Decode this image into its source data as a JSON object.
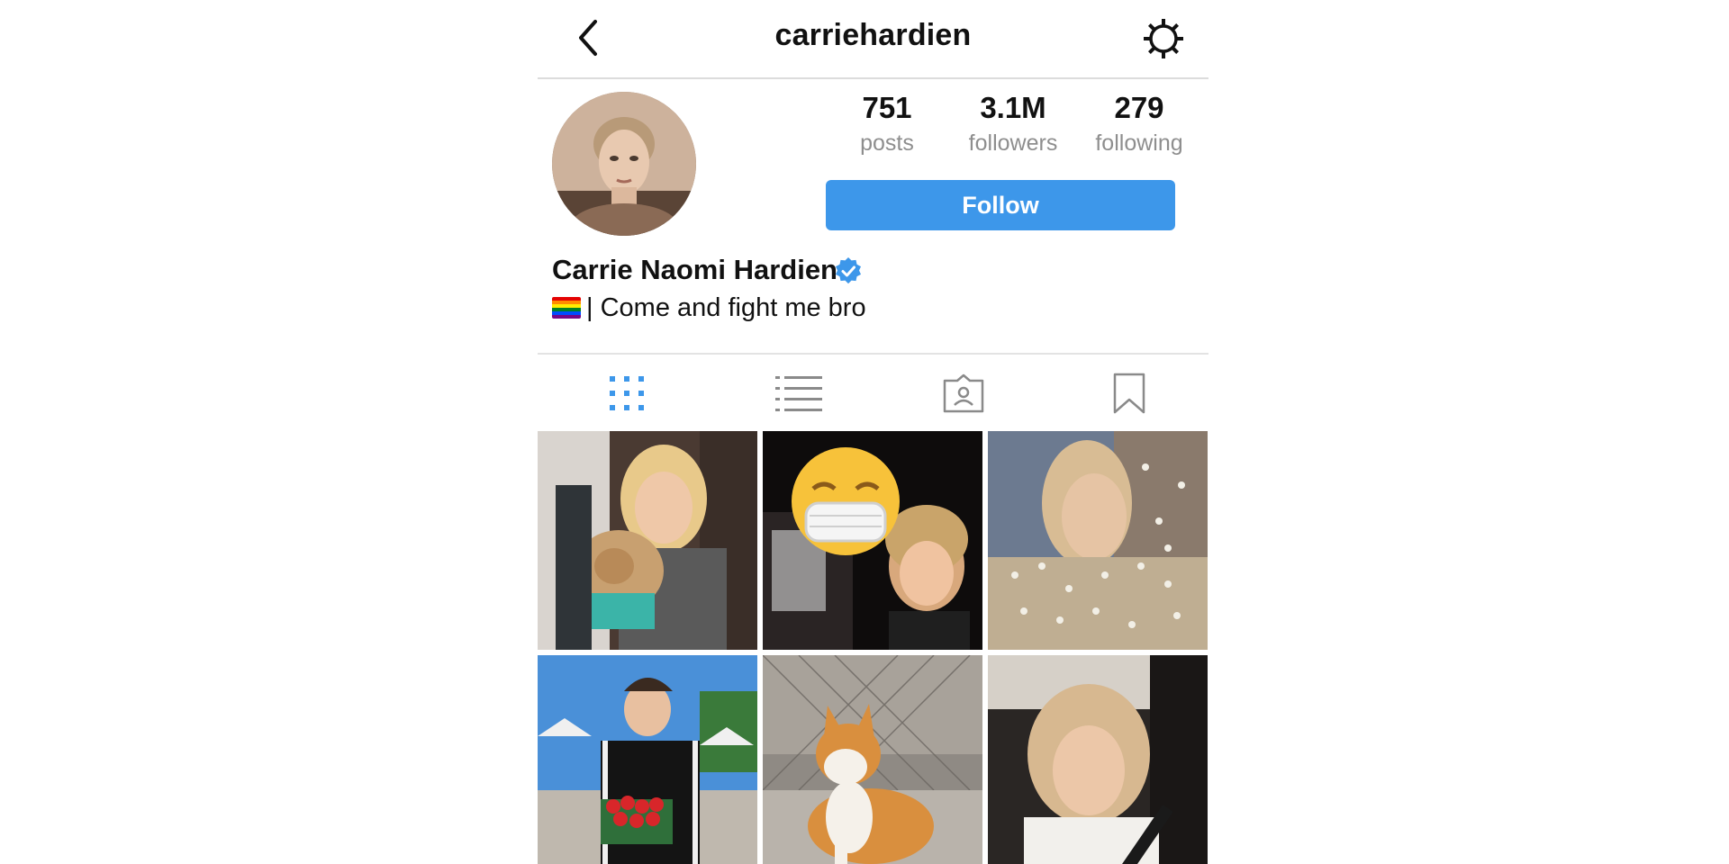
{
  "header": {
    "username": "carriehardien",
    "back_icon": "chevron-left-icon",
    "settings_icon": "gear-icon"
  },
  "profile": {
    "stats": [
      {
        "count": "751",
        "label": "posts"
      },
      {
        "count": "3.1M",
        "label": "followers"
      },
      {
        "count": "279",
        "label": "following"
      }
    ],
    "follow_label": "Follow",
    "full_name": "Carrie Naomi Hardien",
    "verified": true,
    "bio": "| Come and fight me bro",
    "bio_flag": "rainbow-flag-emoji"
  },
  "tabs": [
    {
      "name": "grid-view",
      "icon": "grid-icon",
      "active": true
    },
    {
      "name": "list-view",
      "icon": "list-icon",
      "active": false
    },
    {
      "name": "tagged",
      "icon": "tagged-person-icon",
      "active": false
    },
    {
      "name": "saved",
      "icon": "bookmark-icon",
      "active": false
    }
  ],
  "colors": {
    "accent": "#3d97ea",
    "muted_text": "#8e8e8e",
    "divider": "#dcdcdc",
    "icon_gray": "#8a8a8a"
  },
  "posts": [
    {
      "name": "post-photo-girl-with-puppy"
    },
    {
      "name": "post-photo-emoji-selfie"
    },
    {
      "name": "post-photo-flowers-portrait"
    },
    {
      "name": "post-photo-boy-with-strawberries"
    },
    {
      "name": "post-photo-corgi"
    },
    {
      "name": "post-photo-car-selfie"
    }
  ]
}
